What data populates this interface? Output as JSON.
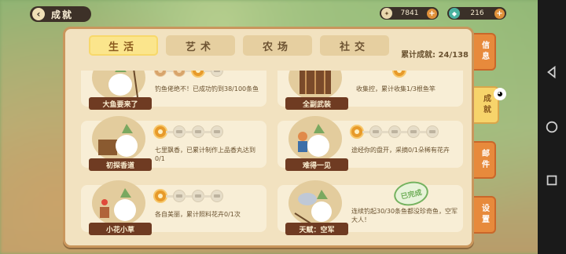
{
  "header": {
    "back_label": "‹",
    "title": "成就"
  },
  "currency": [
    {
      "icon": "coin-icon",
      "value": "7841"
    },
    {
      "icon": "gem-icon",
      "value": "216"
    }
  ],
  "tabs": [
    {
      "label": "生活",
      "active": true
    },
    {
      "label": "艺术",
      "active": false
    },
    {
      "label": "农场",
      "active": false
    },
    {
      "label": "社交",
      "active": false
    }
  ],
  "total_label": "累计成就: 24/138",
  "cards": [
    {
      "name": "大鱼要来了",
      "progress": [
        "dim",
        "dim",
        "on",
        "off"
      ],
      "desc": "钓鱼佬绝不！已成功钓到38/100条鱼"
    },
    {
      "name": "全副武装",
      "progress": [
        "on"
      ],
      "desc": "收集控，累计收集1/3根鱼竿"
    },
    {
      "name": "初探香道",
      "progress": [
        "on",
        "off",
        "off",
        "off"
      ],
      "desc": "七里飘香，已累计制作上品香丸达到0/1"
    },
    {
      "name": "难得一见",
      "progress": [
        "on",
        "off",
        "off",
        "off",
        "off"
      ],
      "desc": "途经你的盘开，采摘0/1朵稀有花卉"
    },
    {
      "name": "小花小草",
      "progress": [
        "on",
        "off",
        "off",
        "off"
      ],
      "desc": "各自美丽，累计照料花卉0/1次"
    },
    {
      "name": "天赋：空军",
      "progress": [],
      "stamp": "已完成",
      "desc": "连续钓起30/30条鱼都没珍奇鱼，空军大人！"
    }
  ],
  "side_tabs": [
    {
      "label": "信息",
      "active": false
    },
    {
      "label": "成就",
      "active": true
    },
    {
      "label": "邮件",
      "active": false
    },
    {
      "label": "设置",
      "active": false
    }
  ],
  "colors": {
    "panel": "#f2e2c0",
    "accent": "#e79a2a",
    "side_tab": "#e78a3c",
    "ribbon": "#6f3b22"
  }
}
